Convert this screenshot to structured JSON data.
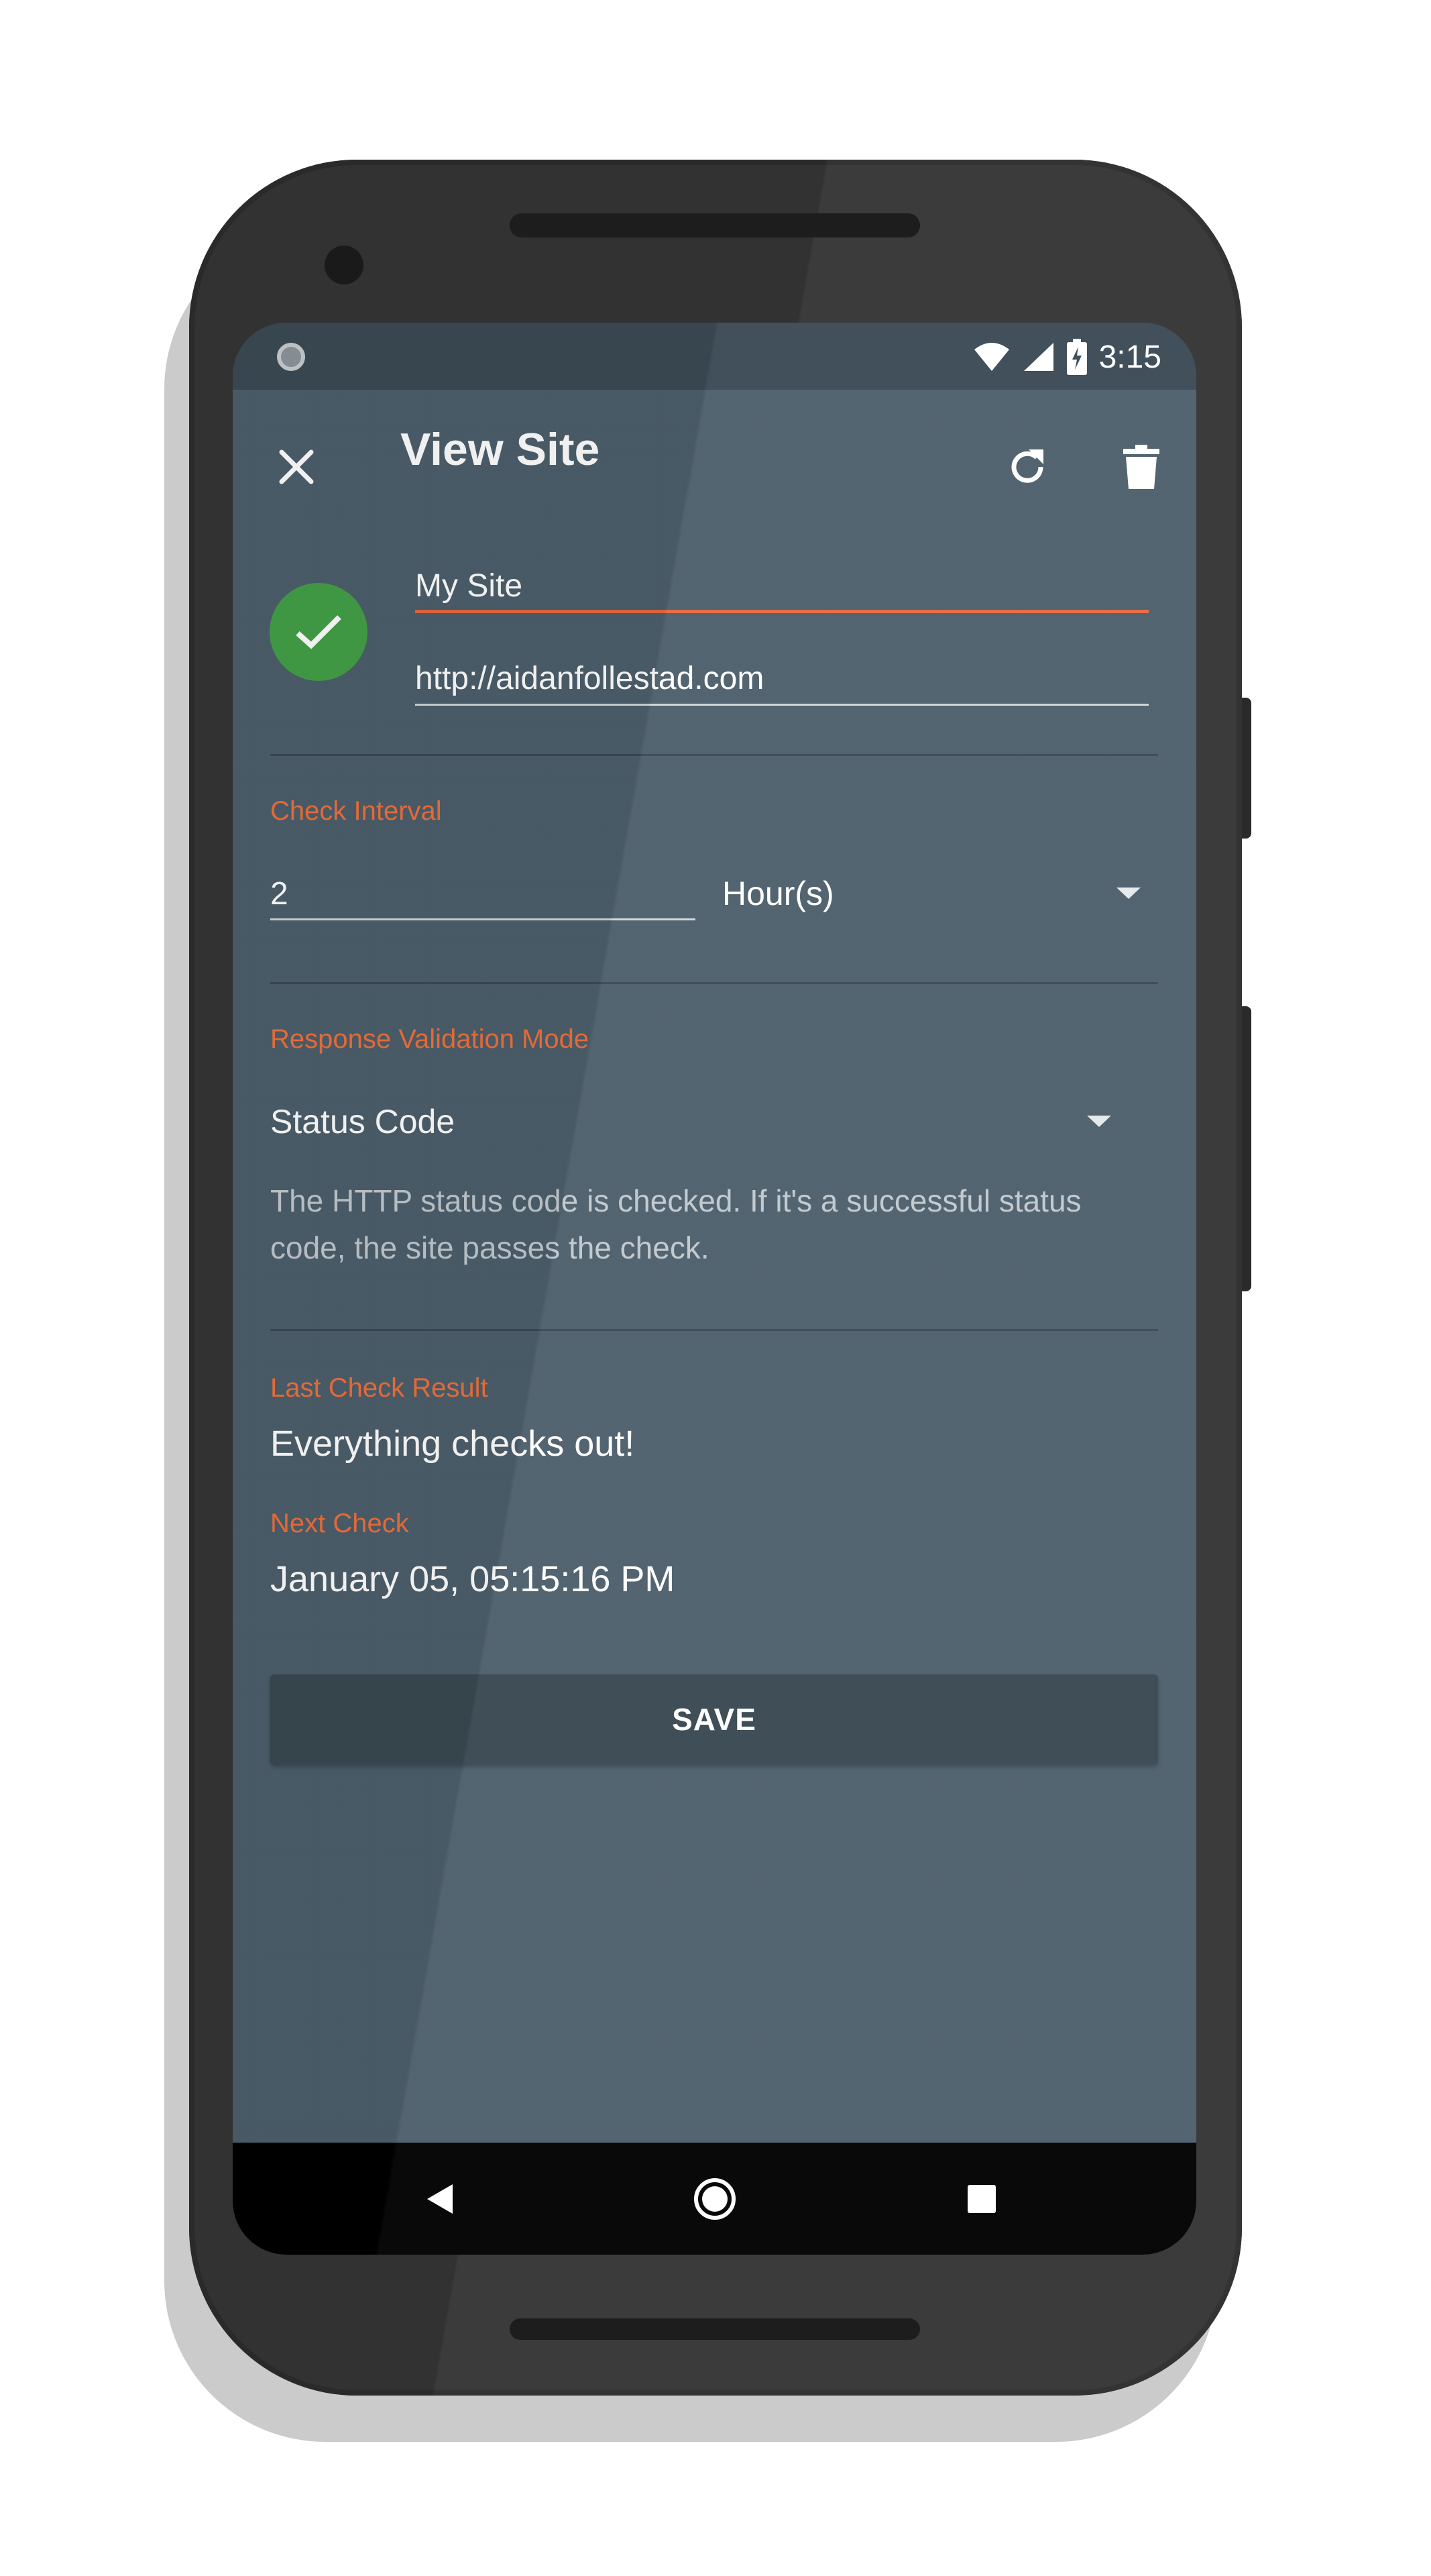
{
  "status_bar": {
    "time": "3:15",
    "icons": [
      "notification-dot-icon",
      "wifi-icon",
      "cell-signal-icon",
      "battery-charging-icon"
    ]
  },
  "toolbar": {
    "title": "View Site",
    "close_icon": "close-icon",
    "refresh_icon": "refresh-icon",
    "delete_icon": "delete-icon"
  },
  "site": {
    "status_icon": "check-icon",
    "status_color": "#43a047",
    "name": "My Site",
    "url": "http://aidanfollestad.com"
  },
  "check_interval": {
    "label": "Check Interval",
    "value": "2",
    "unit": "Hour(s)"
  },
  "validation": {
    "label": "Response Validation Mode",
    "mode": "Status Code",
    "description": "The HTTP status code is checked. If it's a successful status code, the site passes the check."
  },
  "last_check": {
    "label": "Last Check Result",
    "value": "Everything checks out!"
  },
  "next_check": {
    "label": "Next Check",
    "value": "January 05, 05:15:16 PM"
  },
  "save_label": "SAVE",
  "nav": {
    "back_icon": "back-icon",
    "home_icon": "home-icon",
    "recents_icon": "recents-icon"
  },
  "colors": {
    "accent": "#f0703c",
    "background": "#4d5f6b",
    "toolbar_dark": "#3b4a55"
  }
}
